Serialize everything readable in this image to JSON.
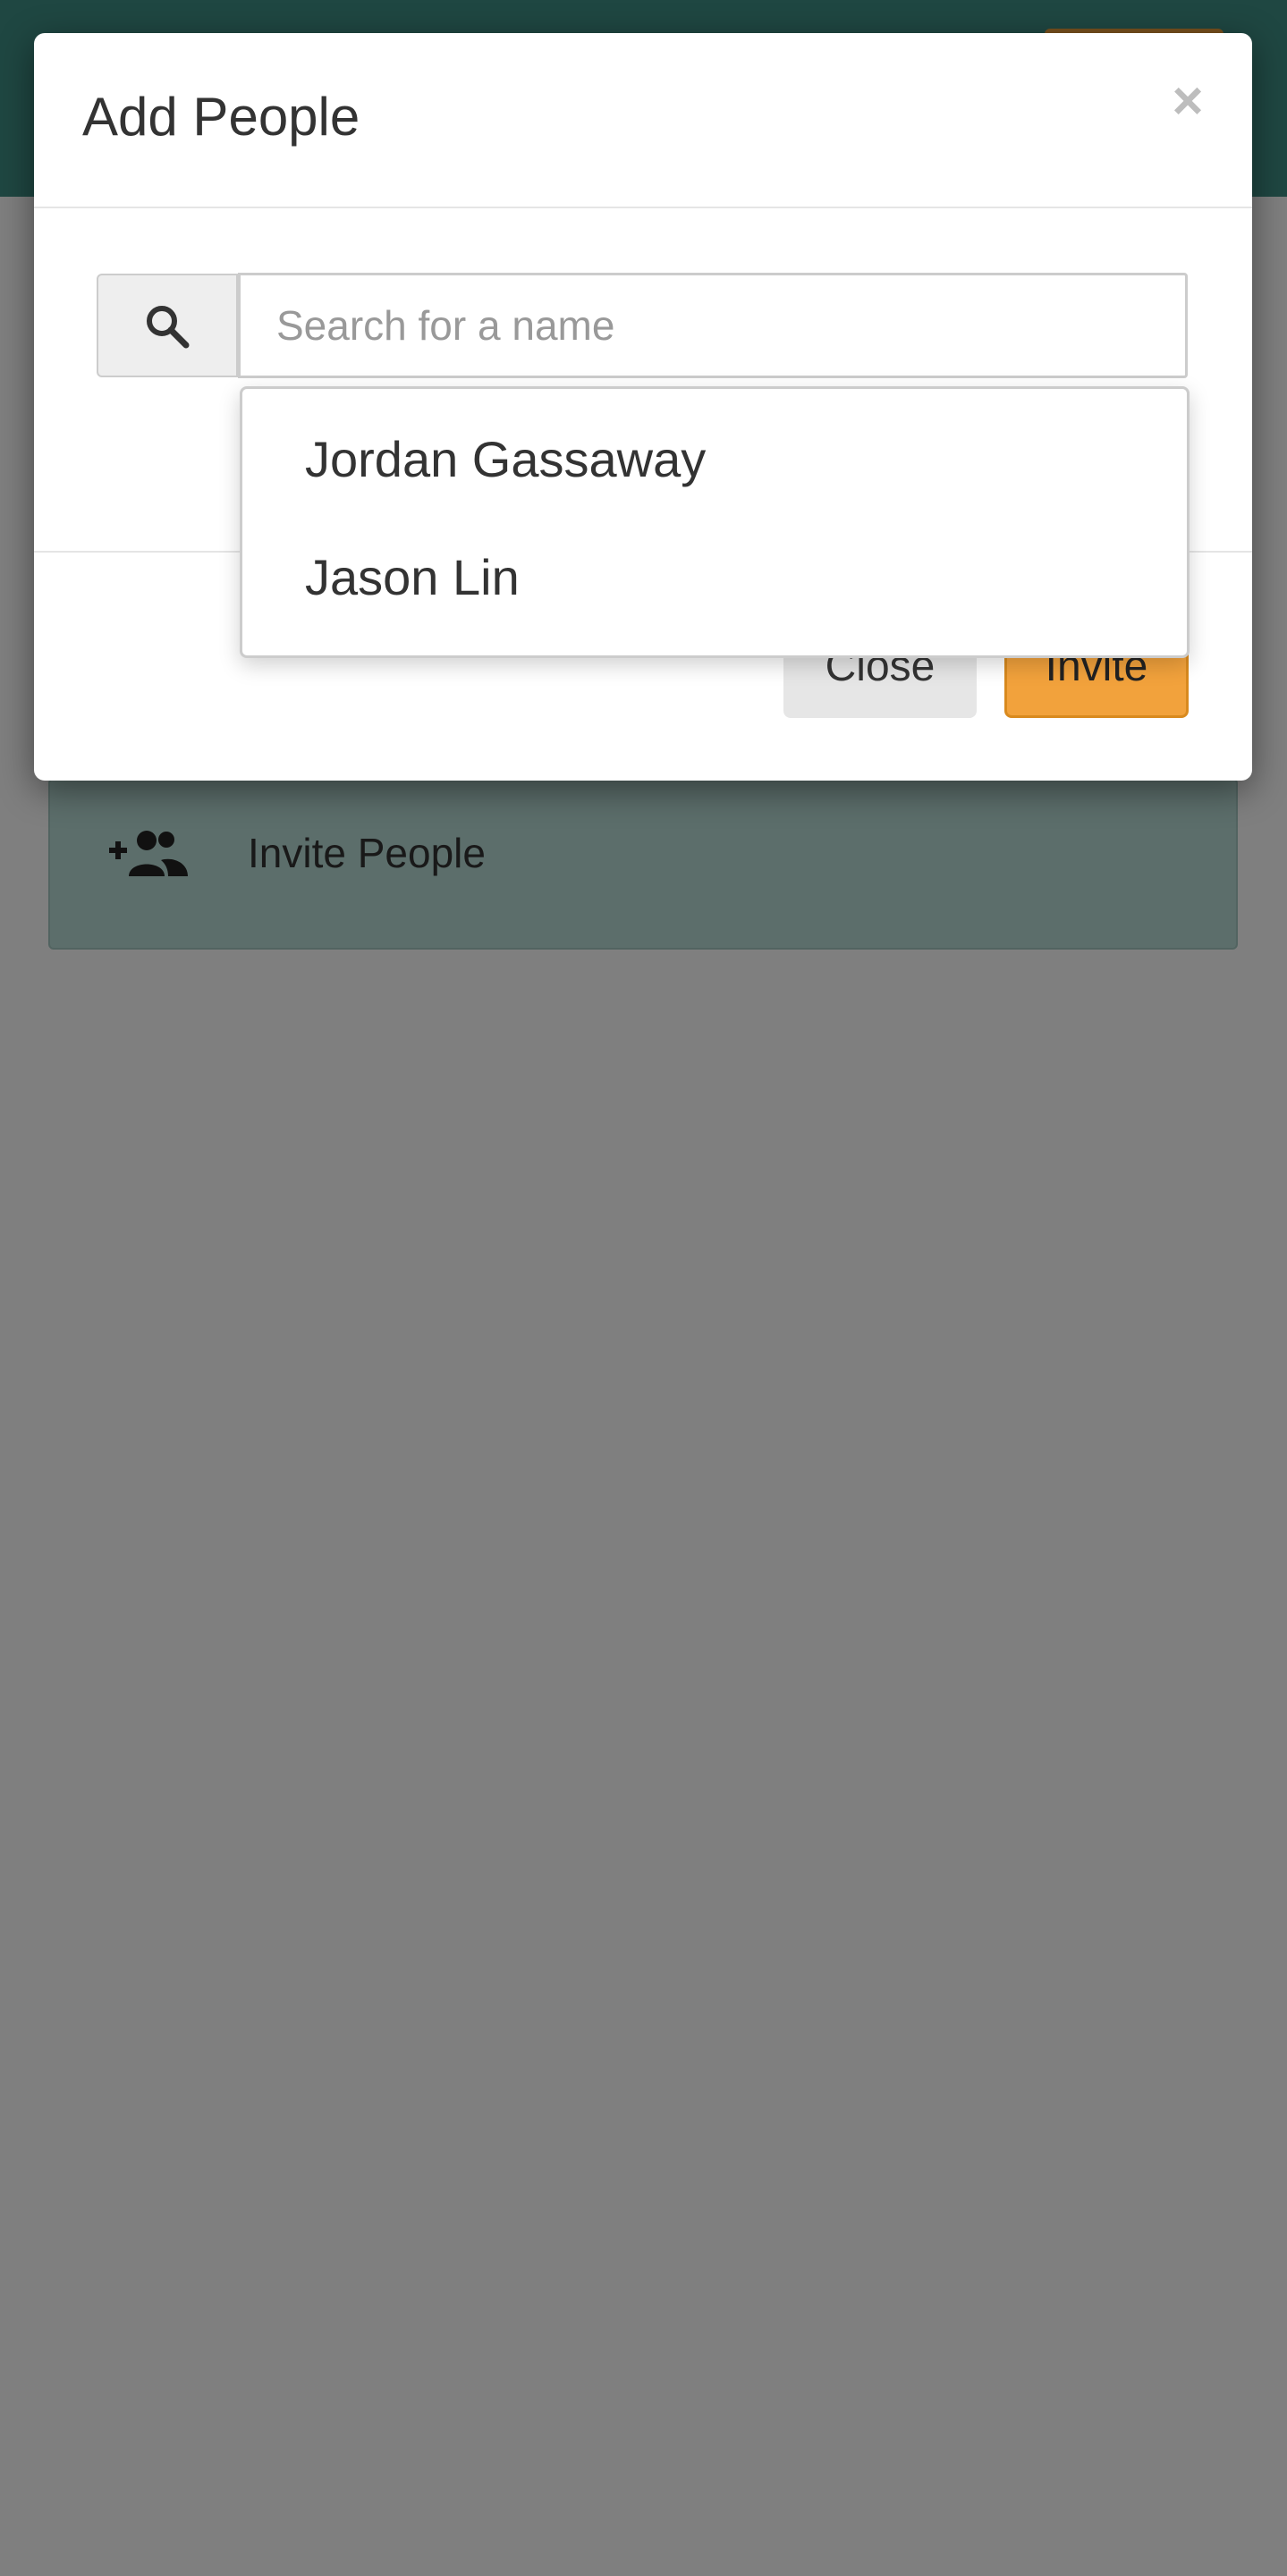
{
  "modal": {
    "title": "Add People",
    "close_icon": "×",
    "search": {
      "placeholder": "Search for a name",
      "value": "",
      "icon": "search-icon"
    },
    "suggestions": [
      {
        "name": "Jordan Gassaway"
      },
      {
        "name": "Jason Lin"
      }
    ],
    "buttons": {
      "close_label": "Close",
      "invite_label": "Invite"
    }
  },
  "background": {
    "invite_panel": {
      "label": "Invite People",
      "icon": "add-group-icon"
    }
  },
  "colors": {
    "header_teal": "#3e8e84",
    "accent_orange": "#f2a23c",
    "panel_teal_light": "#b9ddd6"
  }
}
